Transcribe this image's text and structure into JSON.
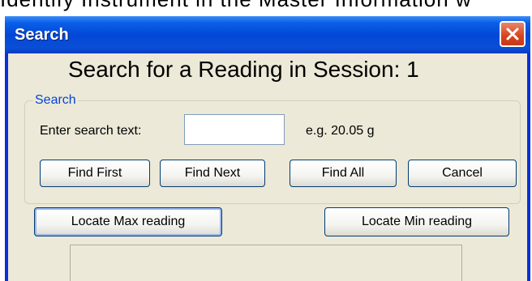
{
  "background_text": "Identify Instrument in the Master Information w",
  "window": {
    "title": "Search",
    "heading": "Search for a Reading in Session: 1"
  },
  "search_group": {
    "legend": "Search",
    "label": "Enter search text:",
    "input_value": "",
    "hint": "e.g. 20.05 g"
  },
  "buttons": {
    "find_first": "Find First",
    "find_next": "Find Next",
    "find_all": "Find All",
    "cancel": "Cancel",
    "locate_max": "Locate Max reading",
    "locate_min": "Locate Min reading"
  },
  "colors": {
    "title_bar": "#0447d8",
    "window_bg": "#ece9d8",
    "group_legend": "#0046d5",
    "close_button": "#d6441c"
  },
  "icons": {
    "close": "close-icon"
  }
}
